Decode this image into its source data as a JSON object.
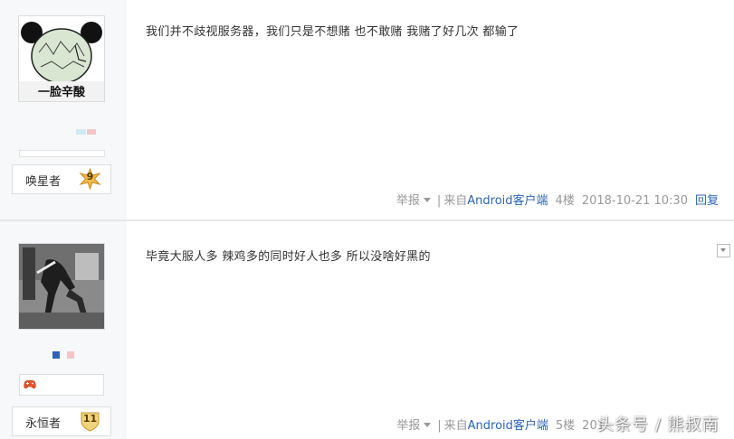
{
  "posts": [
    {
      "avatar_caption": "一脸辛酸",
      "rank_label": "唤星者",
      "rank_level": "9",
      "content": "我们并不歧视服务器，我们只是不想赌 也不敢赌 我赌了好几次 都输了",
      "report_label": "举报",
      "source_prefix": "来自",
      "source_link": "Android客户端",
      "floor": "4楼",
      "time": "2018-10-21 10:30",
      "reply_label": "回复"
    },
    {
      "rank_label": "永恒者",
      "rank_level": "11",
      "content": "毕竟大服人多 辣鸡多的同时好人也多 所以没啥好黑的",
      "report_label": "举报",
      "source_prefix": "来自",
      "source_link": "Android客户端",
      "floor": "5楼",
      "time": "201"
    }
  ],
  "watermark": "头条号 / 熊叔南",
  "colors": {
    "link": "#2d64b3",
    "meta": "#999999",
    "sidebar": "#f7f8fa"
  }
}
